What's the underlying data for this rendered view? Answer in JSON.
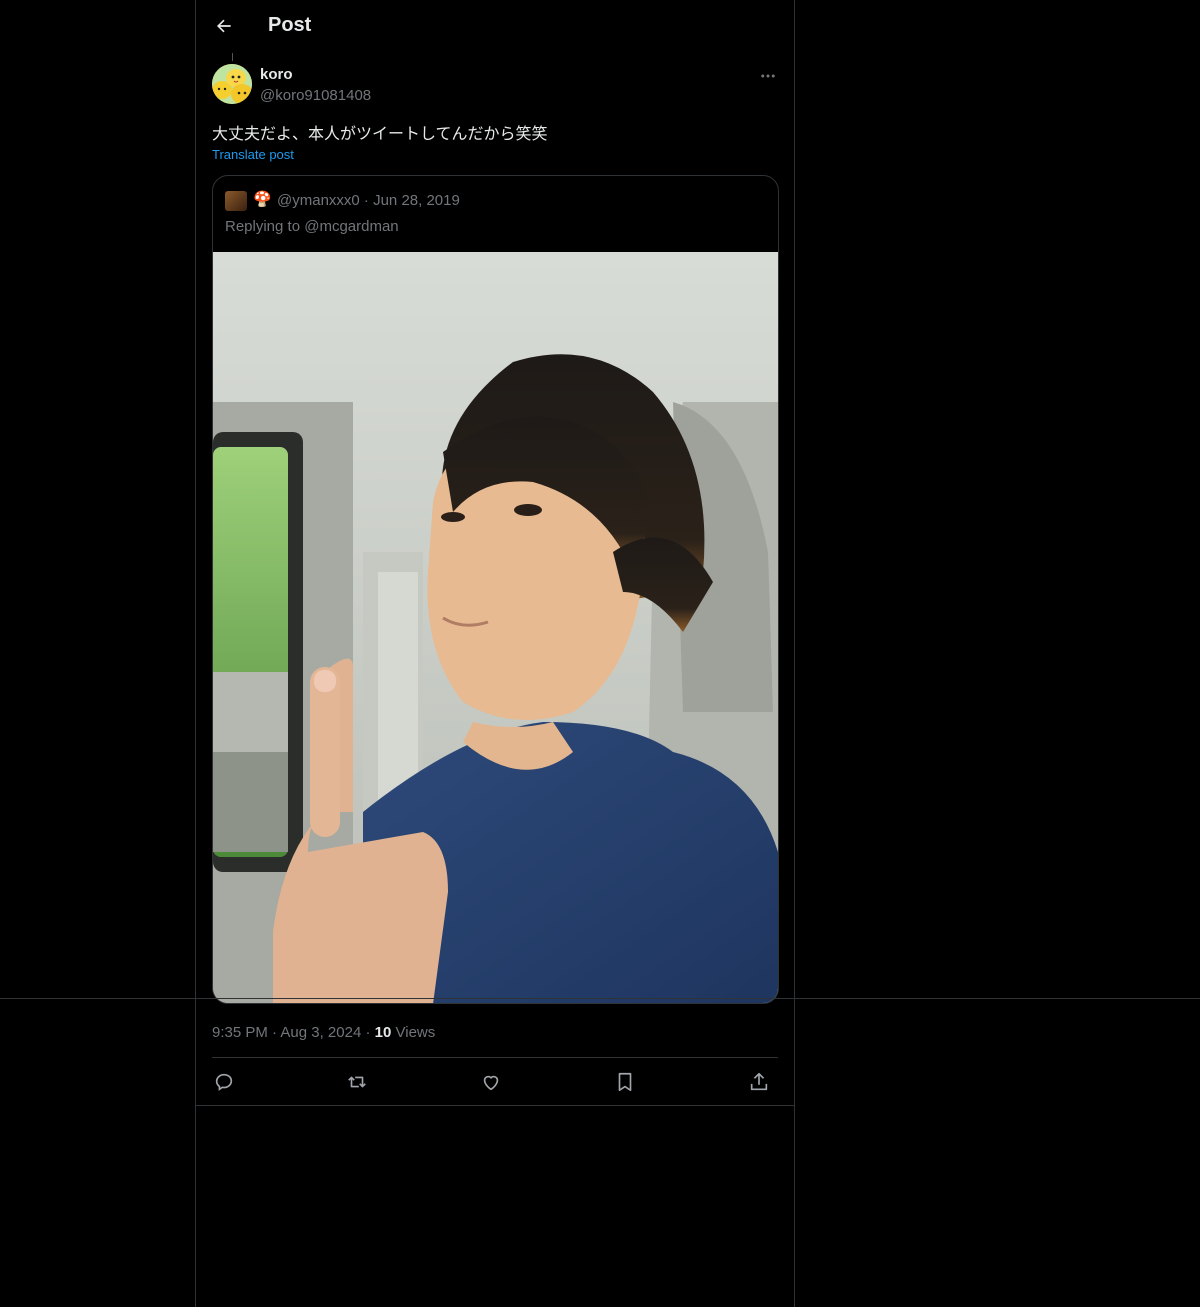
{
  "header": {
    "title": "Post"
  },
  "post": {
    "author_name": "koro",
    "author_handle": "@koro91081408",
    "text": "大丈夫だよ、本人がツイートしてんだから笑笑",
    "translate_label": "Translate post",
    "time": "9:35 PM",
    "date": "Aug 3, 2024",
    "views_count": "10",
    "views_label": "Views"
  },
  "quote": {
    "emoji": "🍄",
    "handle": "@ymanxxx0",
    "date": "Jun 28, 2019",
    "replying_prefix": "Replying to",
    "replying_to": "@mcgardman"
  },
  "icons": {
    "back": "back-arrow-icon",
    "more": "more-options-icon",
    "reply": "reply-icon",
    "repost": "repost-icon",
    "like": "like-icon",
    "bookmark": "bookmark-icon",
    "share": "share-icon"
  },
  "colors": {
    "background": "#000000",
    "link": "#1d9bf0",
    "muted": "#71767b",
    "text": "#e7e9ea",
    "border": "#2f3336"
  }
}
